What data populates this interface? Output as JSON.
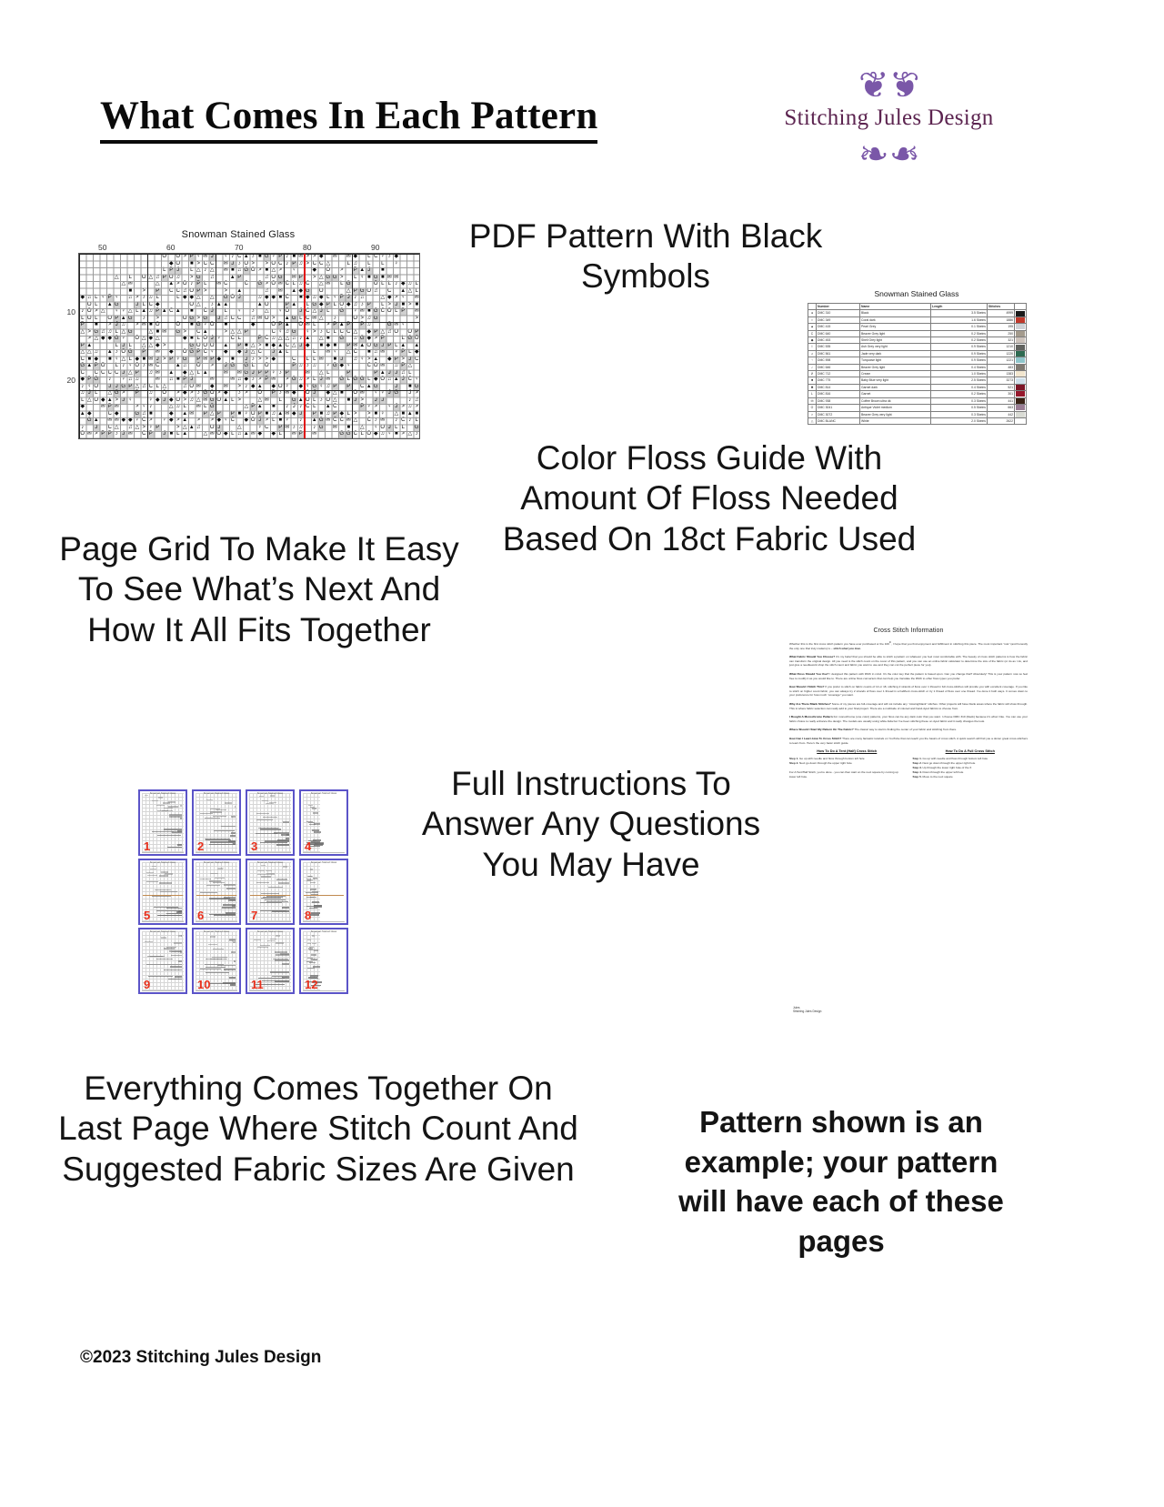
{
  "header": {
    "title": "What Comes In Each Pattern",
    "logo": {
      "brand": "Stitching Jules Design",
      "flourish": "❧❧",
      "color": "#5c2450",
      "accent": "#7a57a8"
    }
  },
  "blurbs": {
    "pdf_pattern": "PDF Pattern With Black Symbols",
    "page_grid": "Page Grid To Make It Easy To See What’s Next And How It All Fits Together",
    "floss_guide": "Color Floss Guide With Amount Of Floss Needed Based On 18ct Fabric Used",
    "instructions": "Full Instructions To Answer Any Questions You May Have",
    "last_page": "Everything Comes Together On Last Page Where Stitch Count And Suggested Fabric Sizes Are Given",
    "disclaimer": "Pattern shown is an example; your pattern will have each of these pages"
  },
  "copyright": "©2023 Stitching Jules Design",
  "chart": {
    "title": "Snowman Stained Glass",
    "column_labels": [
      "50",
      "60",
      "70",
      "80",
      "90"
    ],
    "row_labels": [
      "10",
      "20"
    ],
    "center_marker_color": "#e01010"
  },
  "floss_table": {
    "title": "Snowman Stained Glass",
    "columns": [
      "",
      "Number",
      "Name",
      "Length",
      "Stitches"
    ],
    "rows": [
      {
        "symbol": "●",
        "number": "DMC    310",
        "name": "Black",
        "length": "3.5 Skeins",
        "stitches": "4999",
        "color": "#1a1a1a"
      },
      {
        "symbol": "▪",
        "number": "DMC    349",
        "name": "Coral dark",
        "length": "1.6 Skeins",
        "stitches": "1886",
        "color": "#c0392b"
      },
      {
        "symbol": "▲",
        "number": "DMC    415",
        "name": "Pearl Grey",
        "length": "0.1 Skeins",
        "stitches": "195",
        "color": "#cfd2d6"
      },
      {
        "symbol": "C",
        "number": "DMC    640",
        "name": "Beaver Grey light",
        "length": "0.2 Skeins",
        "stitches": "250",
        "color": "#a49b8d"
      },
      {
        "symbol": "◆",
        "number": "DMC    453",
        "name": "Shell Grey light",
        "length": "0.2 Skeins",
        "stitches": "321",
        "color": "#cdc3bc"
      },
      {
        "symbol": "I",
        "number": "DMC    535",
        "name": "Ash Grey very light",
        "length": "0.9 Skeins",
        "stitches": "1210",
        "color": "#61635f"
      },
      {
        "symbol": "♫",
        "number": "DMC    561",
        "name": "Jade very dark",
        "length": "0.9 Skeins",
        "stitches": "1220",
        "color": "#2e6b52"
      },
      {
        "symbol": "♀",
        "number": "DMC    598",
        "name": "Turquoise light",
        "length": "0.9 Skeins",
        "stitches": "1221",
        "color": "#8fc6cb"
      },
      {
        "symbol": "♪",
        "number": "DMC    646",
        "name": "Beaver Grey light",
        "length": "0.4 Skeins",
        "stitches": "483",
        "color": "#807a72"
      },
      {
        "symbol": "✗",
        "number": "DMC    712",
        "name": "Cream",
        "length": "1.0 Skeins",
        "stitches": "1383",
        "color": "#f2e6cf"
      },
      {
        "symbol": "■",
        "number": "DMC    775",
        "name": "Baby Blue very light",
        "length": "2.5 Skeins",
        "stitches": "3273",
        "color": "#cfe0ec"
      },
      {
        "symbol": "✖",
        "number": "DMC    814",
        "name": "Garnet dark",
        "length": "0.4 Skeins",
        "stitches": "521",
        "color": "#7d1527"
      },
      {
        "symbol": "L",
        "number": "DMC    816",
        "name": "Garnet",
        "length": "0.2 Skeins",
        "stitches": "301",
        "color": "#96182c"
      },
      {
        "symbol": "✉",
        "number": "DMC    938",
        "name": "Coffee Brown ultra dk",
        "length": "0.3 Skeins",
        "stitches": "441",
        "color": "#3b2316"
      },
      {
        "symbol": "O",
        "number": "DMC    3041",
        "name": "Antique Violet medium",
        "length": "0.5 Skeins",
        "stitches": "663",
        "color": "#9a7d94"
      },
      {
        "symbol": ">",
        "number": "DMC    3072",
        "name": "Beaver Grey very light",
        "length": "0.3 Skeins",
        "stitches": "442",
        "color": "#d9dbd4"
      },
      {
        "symbol": "△",
        "number": "DMC    BLANC",
        "name": "White",
        "length": "2.0 Skeins",
        "stitches": "2622",
        "color": "#ffffff"
      }
    ]
  },
  "page_grid": {
    "thumbnails": [
      "1",
      "2",
      "3",
      "4",
      "5",
      "6",
      "7",
      "8",
      "9",
      "10",
      "11",
      "12"
    ],
    "border_color": "#5b54c8",
    "number_color": "#e8301c",
    "thumb_title": "Snowman Stained Glass"
  },
  "instructions": {
    "heading": "Cross Stitch Information",
    "paragraphs": [
      {
        "lead": "",
        "text": "Whether this is the first cross stitch pattern you have ever purchased or the 100<sup>th</sup>, I hope that you find enjoyment and fulfillment in stitching this piece. The most important “rule” (and honestly the only one that truly matters) is – <i>stitch what you love.</i>"
      },
      {
        "lead": "What Fabric Should You Choose?",
        "text": " It’s my belief that you should be able to stitch a pattern on whatever you feel most comfortable with. The beauty of cross stitch patterns is how the fabric can transform the original design. All you need is the stitch count on the cover of this pattern, and you can use an online fabric calculator to determine the size of the fabric (or do as I do, and just give a needlework shop the stitch count and fabric you want to use and they can cut the perfect piece for you)."
      },
      {
        "lead": "What Floss Should You Use?",
        "text": " I designed this pattern with DMC in mind. It’s the color key that the pattern is based upon. Can you change that? Absolutely! This is your pattern now so feel free to modify it as you would like to. There are online floss converters that can help you translate the DMC to other floss types you prefer."
      },
      {
        "lead": "How Should I Stitch This?",
        "text": " If you prefer to stitch on fabric counts of 14 or 18, stitching 2 strands of floss over 1 thread in full cross-stitches will provide you with excellent coverage. If you like to stitch on higher count fabric, you can always try 2 strands of floss over 1 thread in a half/tent cross-stitch or try 1 thread of floss over one thread. I’ve done it both ways. It comes down to your preference for how much “coverage” you want."
      },
      {
        "lead": "Why Are There Blank Stitches?",
        "text": " Some of my pieces are full-coverage and will not include any “missing/blank” stitches. Other projects will have blank areas where the fabric will show through. This is where fabric selection can really add to your final project. There are a multitude of colored and hand-dyed fabrics to choose from."
      },
      {
        "lead": "I Bought A Monochrome Pattern",
        "text": " For monochrome (one color) patterns, your floss can be any dark color that you want. I choose DMC 310 (black) because it’s what I like. You can use your fabric choice to really enhance the design. The models are usually using white Aida but I’ve been stitching these on dyed fabric and it really changes the look."
      },
      {
        "lead": "Where Should I Start My Pattern On The Fabric?",
        "text": " The classic way to start is finding the center of your fabric and stitching from there."
      },
      {
        "lead": "How Can I Learn How To Cross Stitch?",
        "text": " There are many fantastic tutorials on YouTube that can teach you the basics of cross stitch. A quick search will find you a dozen great cross-stitchers to learn from. Here’s the very basic stitch guide."
      }
    ],
    "tent_heading": "How To Do A Tent (Half) Cross Stitch",
    "tent_steps": [
      "Step 1. Go up with needle and floss through bottom left hole",
      "Step 2. Next go down through the upper right hole"
    ],
    "tent_note": "For A Tent/Half Stitch, you’re done - you can then start on the next square by coming up lower left hole.",
    "full_heading": "How To Do A Full Cross Stitch",
    "full_steps": [
      "Step 1. Go up with needle and floss through bottom left hole",
      "Step 2. Next go down through the upper right hole",
      "Step 3. Up through the lower right hole of the X",
      "Step 4. Down through the upper left hole",
      "Step 5. Move to the next square"
    ],
    "signature": [
      "Jules",
      "Stitching Jules Design"
    ]
  }
}
